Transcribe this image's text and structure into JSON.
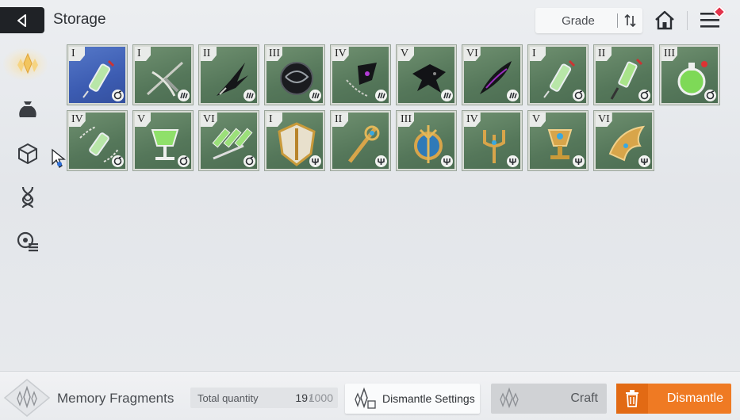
{
  "header": {
    "title": "Storage",
    "sort_label": "Grade"
  },
  "sidebar": {
    "items": [
      {
        "icon": "memory-fragment-icon",
        "active": true
      },
      {
        "icon": "pouch-icon",
        "active": false
      },
      {
        "icon": "cube-icon",
        "active": false
      },
      {
        "icon": "dna-icon",
        "active": false
      },
      {
        "icon": "skill-list-icon",
        "active": false
      }
    ]
  },
  "items": [
    {
      "grade": "I",
      "art": "syringe-blue",
      "badge": "spiral-icon",
      "bg": "blue"
    },
    {
      "grade": "I",
      "art": "crossbow",
      "badge": "claw-icon",
      "bg": "green"
    },
    {
      "grade": "II",
      "art": "dark-claw",
      "badge": "claw-icon",
      "bg": "green"
    },
    {
      "grade": "III",
      "art": "dark-orb",
      "badge": "claw-icon",
      "bg": "green"
    },
    {
      "grade": "IV",
      "art": "chained-wing",
      "badge": "claw-icon",
      "bg": "green"
    },
    {
      "grade": "V",
      "art": "dark-bird",
      "badge": "claw-icon",
      "bg": "green"
    },
    {
      "grade": "VI",
      "art": "dark-feather",
      "badge": "claw-icon",
      "bg": "green"
    },
    {
      "grade": "I",
      "art": "syringe-green",
      "badge": "spiral-icon",
      "bg": "green"
    },
    {
      "grade": "II",
      "art": "syringe-red",
      "badge": "spiral-icon",
      "bg": "green"
    },
    {
      "grade": "III",
      "art": "green-flask",
      "badge": "spiral-icon",
      "bg": "green"
    },
    {
      "grade": "IV",
      "art": "chained-vial",
      "badge": "spiral-icon",
      "bg": "green"
    },
    {
      "grade": "V",
      "art": "goblet",
      "badge": "spiral-icon",
      "bg": "green"
    },
    {
      "grade": "VI",
      "art": "vial-rack",
      "badge": "spiral-icon",
      "bg": "green"
    },
    {
      "grade": "I",
      "art": "gold-shield",
      "badge": "trident-icon",
      "bg": "green"
    },
    {
      "grade": "II",
      "art": "gold-staff",
      "badge": "trident-icon",
      "bg": "green"
    },
    {
      "grade": "III",
      "art": "gold-crest",
      "badge": "trident-icon",
      "bg": "green"
    },
    {
      "grade": "IV",
      "art": "gold-trident",
      "badge": "trident-icon",
      "bg": "green"
    },
    {
      "grade": "V",
      "art": "gold-chalice",
      "badge": "trident-icon",
      "bg": "green"
    },
    {
      "grade": "VI",
      "art": "gold-wing",
      "badge": "trident-icon",
      "bg": "green"
    }
  ],
  "footer": {
    "fragments_label": "Memory Fragments",
    "total_label": "Total quantity",
    "current": "19",
    "slash": "/",
    "max": "1000",
    "settings_label": "Dismantle Settings",
    "craft_label": "Craft",
    "dismantle_label": "Dismantle"
  },
  "colors": {
    "accent_orange": "#ef7a23",
    "card_green": "#5b7d5f",
    "card_blue": "#3f61b6",
    "badge_red": "#e2324a"
  }
}
